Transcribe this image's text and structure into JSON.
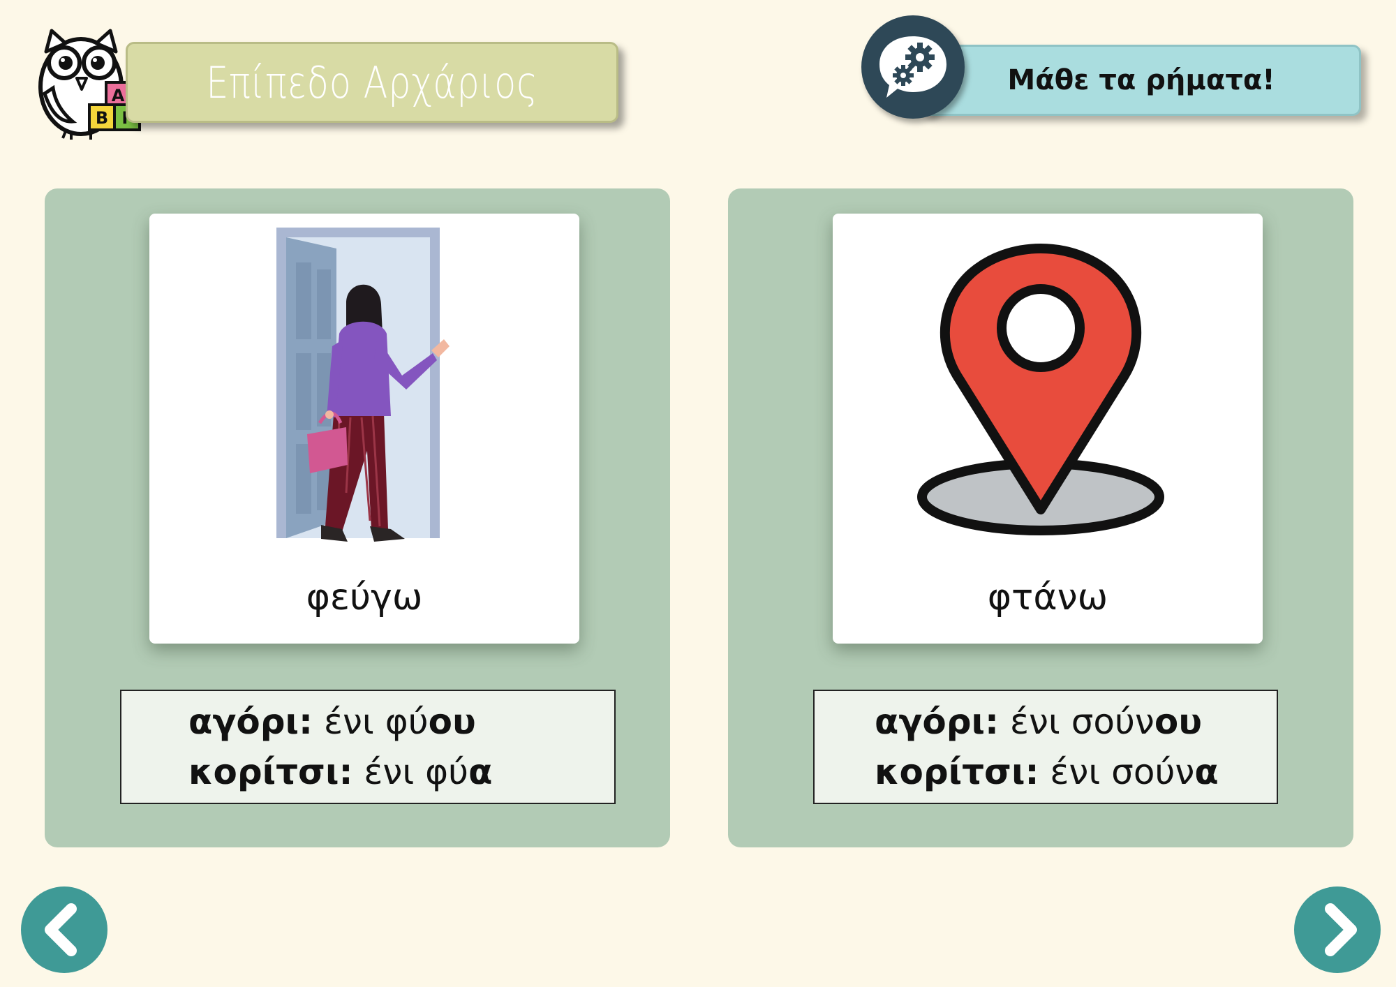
{
  "header": {
    "level_title": "Επίπεδο Αρχάριος",
    "logo_blocks": [
      "Α",
      "Β",
      "Γ"
    ],
    "learn_title": "Μάθε τα ρήματα!"
  },
  "cards": [
    {
      "word": "φεύγω",
      "image_icon": "woman-leaving-through-door",
      "forms": {
        "boy_label": "αγόρι:",
        "boy_stem": "ένι φύ",
        "boy_ending": "ου",
        "girl_label": "κορίτσι:",
        "girl_stem": "ένι φύ",
        "girl_ending": "α"
      }
    },
    {
      "word": "φτάνω",
      "image_icon": "location-pin",
      "forms": {
        "boy_label": "αγόρι:",
        "boy_stem": "ένι σούν",
        "boy_ending": "ου",
        "girl_label": "κορίτσι:",
        "girl_stem": "ένι σούν",
        "girl_ending": "α"
      }
    }
  ],
  "navigation": {
    "prev_icon": "chevron-left-icon",
    "next_icon": "chevron-right-icon"
  },
  "colors": {
    "background": "#fdf8e8",
    "panel": "#b2cbb5",
    "level_banner": "#d8dba5",
    "learn_banner": "#aadddf",
    "nav_button": "#3f9a96",
    "gear_badge": "#2e4857",
    "pin_red": "#e84c3d"
  }
}
